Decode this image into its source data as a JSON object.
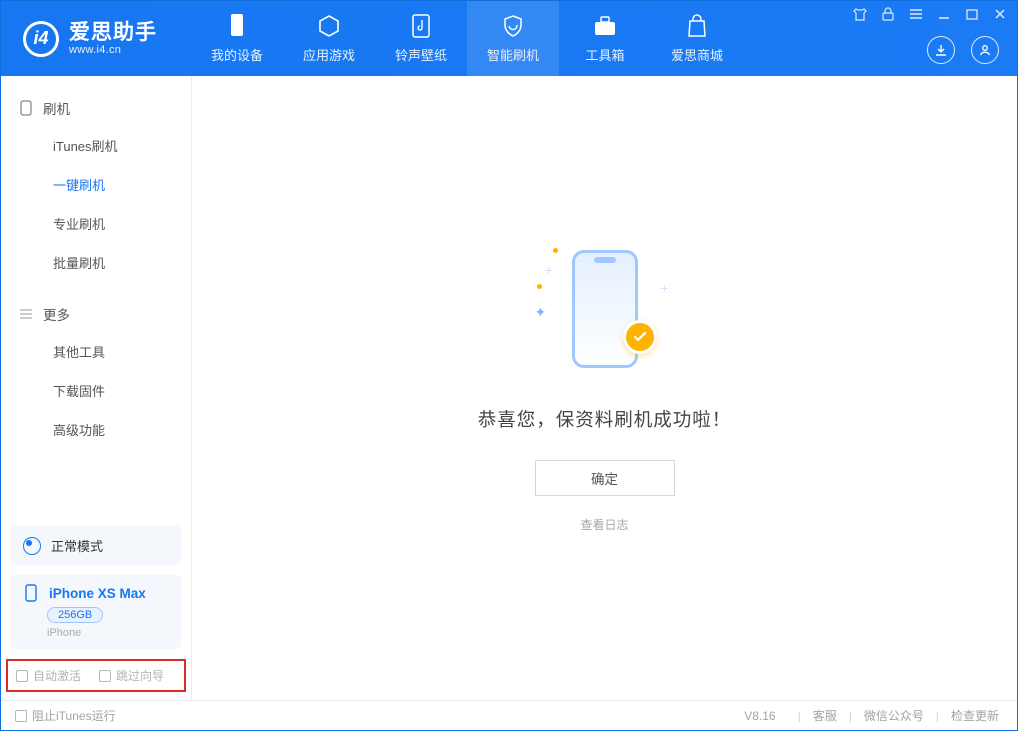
{
  "app": {
    "name_cn": "爱思助手",
    "name_en": "www.i4.cn"
  },
  "nav": {
    "items": [
      {
        "label": "我的设备"
      },
      {
        "label": "应用游戏"
      },
      {
        "label": "铃声壁纸"
      },
      {
        "label": "智能刷机"
      },
      {
        "label": "工具箱"
      },
      {
        "label": "爱思商城"
      }
    ],
    "activeIndex": 3
  },
  "sidebar": {
    "section1": {
      "title": "刷机",
      "items": [
        "iTunes刷机",
        "一键刷机",
        "专业刷机",
        "批量刷机"
      ],
      "activeIndex": 1
    },
    "section2": {
      "title": "更多",
      "items": [
        "其他工具",
        "下载固件",
        "高级功能"
      ]
    }
  },
  "status": {
    "mode": "正常模式"
  },
  "device": {
    "name": "iPhone XS Max",
    "capacity": "256GB",
    "type": "iPhone"
  },
  "options": {
    "auto_activate": "自动激活",
    "skip_guide": "跳过向导"
  },
  "main": {
    "success_text": "恭喜您，保资料刷机成功啦！",
    "ok_button": "确定",
    "view_log": "查看日志"
  },
  "footer": {
    "block_itunes": "阻止iTunes运行",
    "version": "V8.16",
    "links": [
      "客服",
      "微信公众号",
      "检查更新"
    ]
  }
}
